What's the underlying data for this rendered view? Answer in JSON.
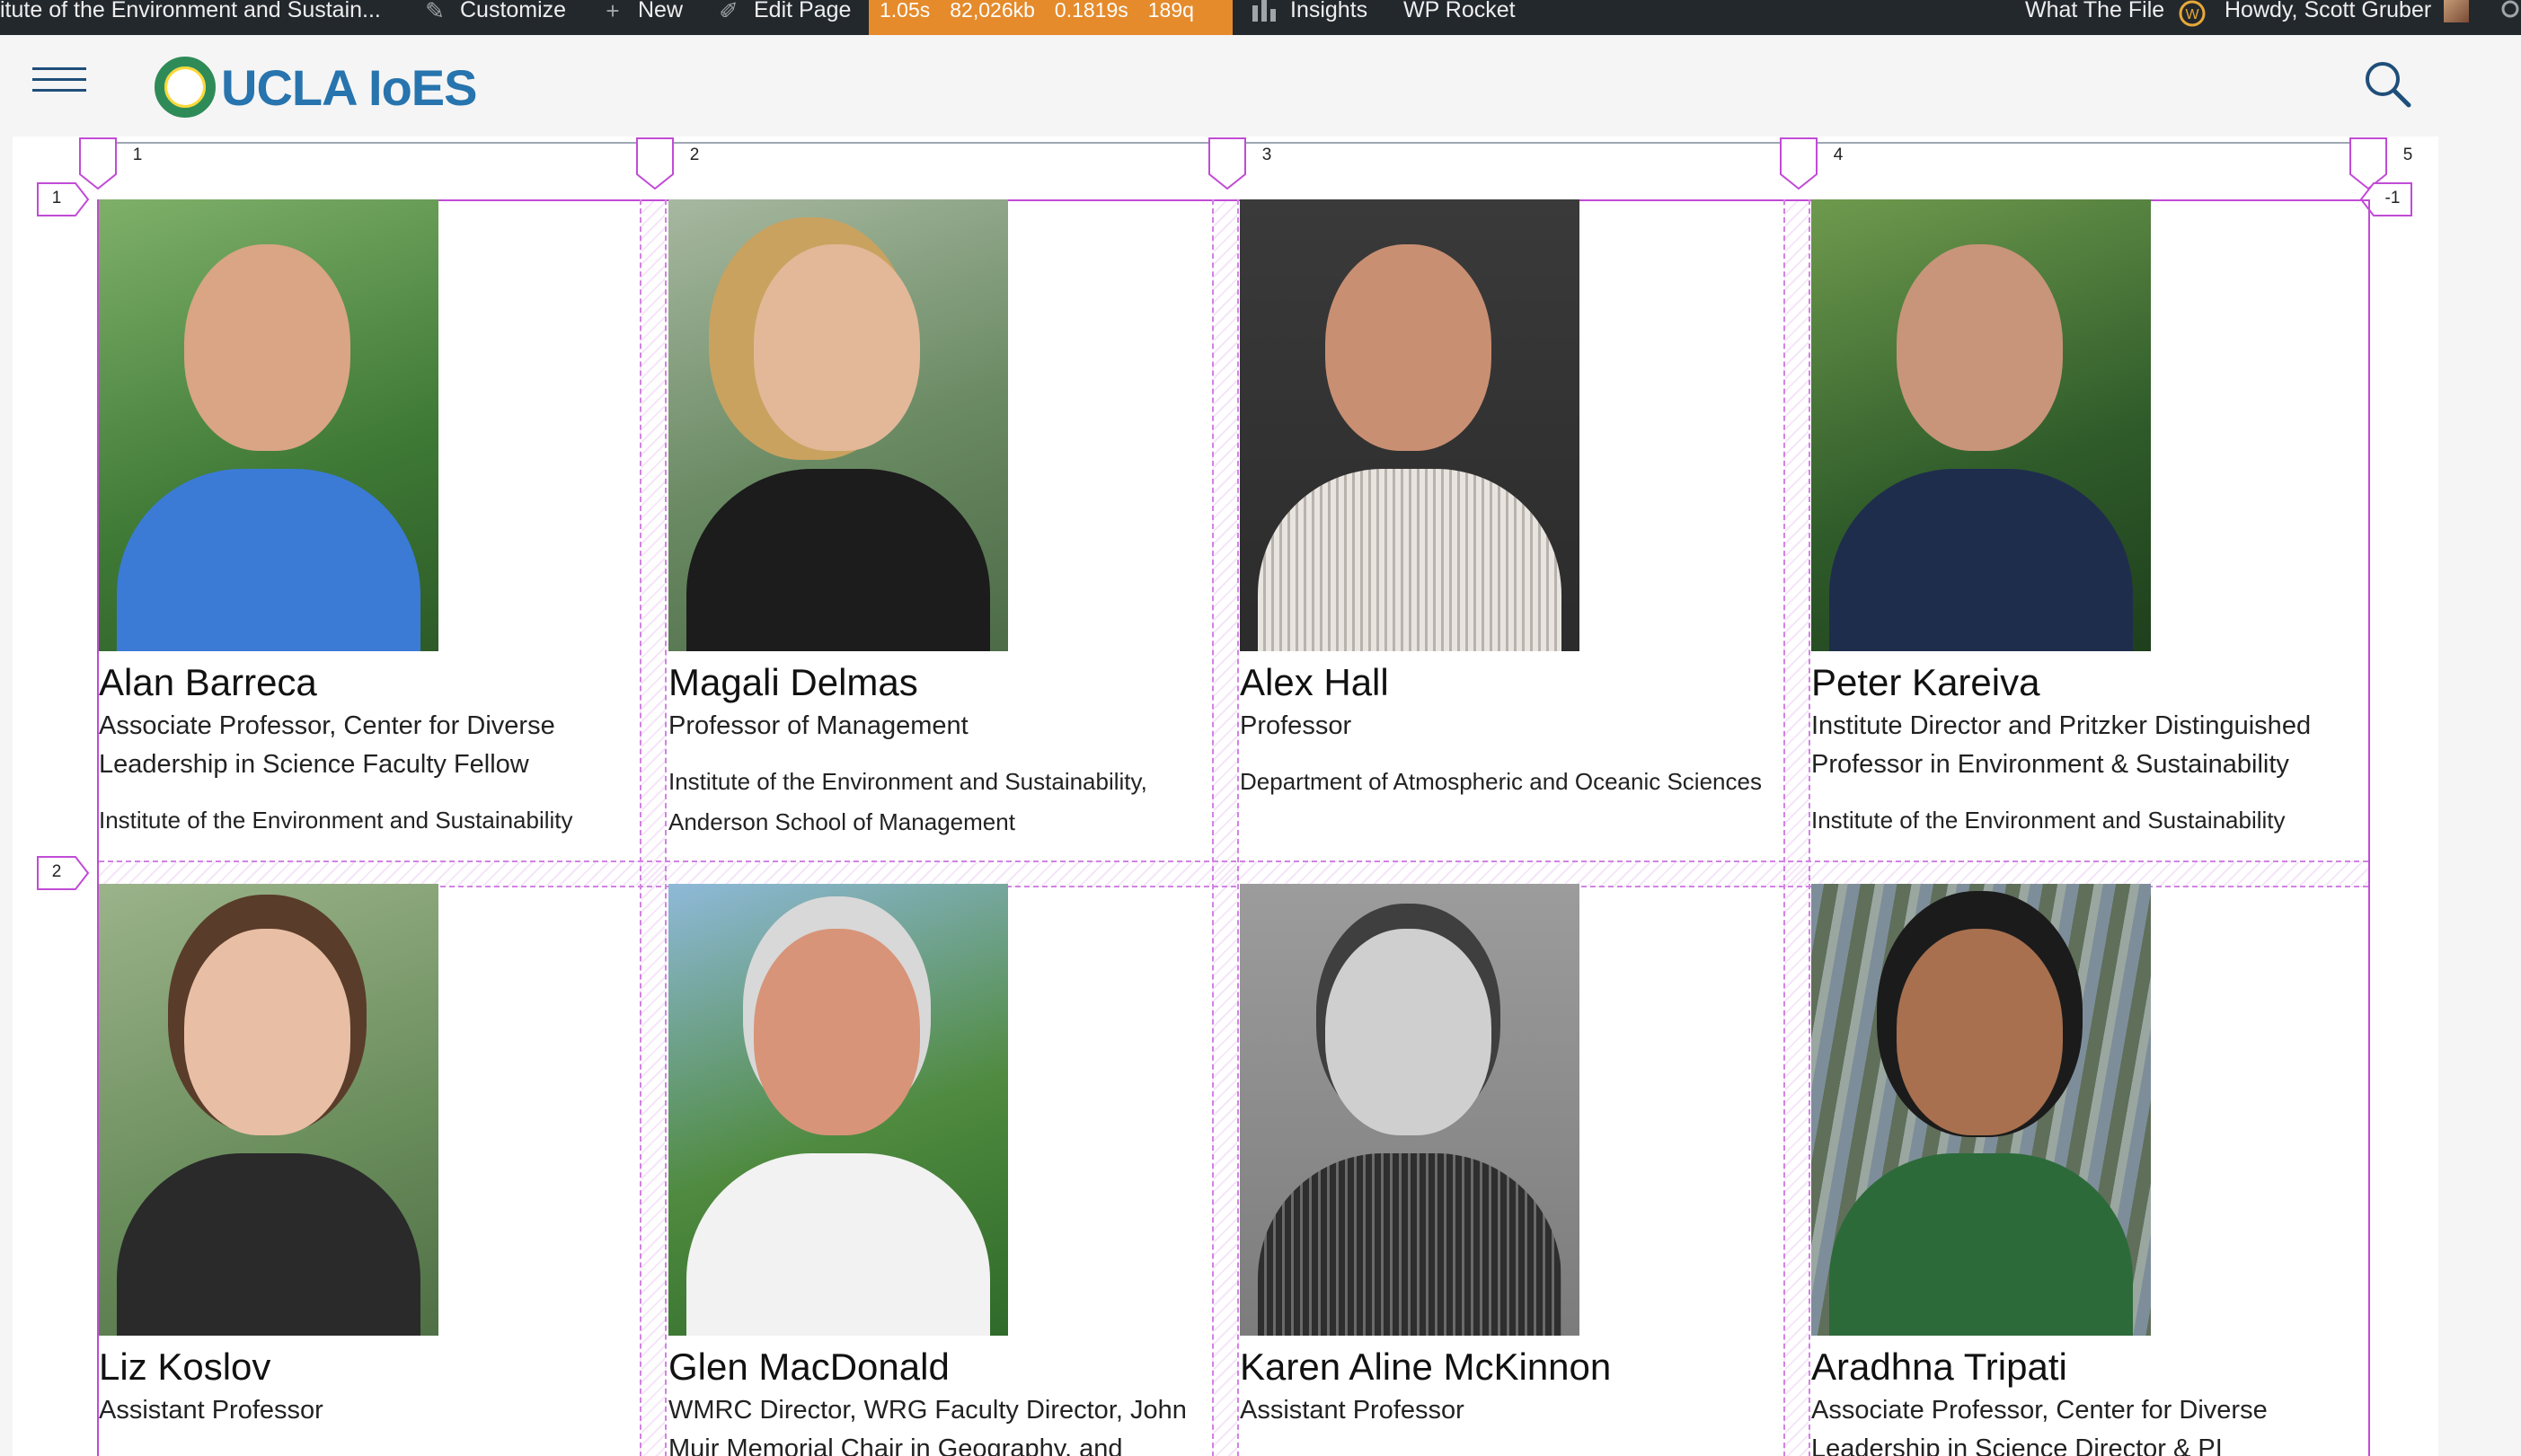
{
  "admin_bar": {
    "site_name": "itute of the Environment and Sustain...",
    "customize": "Customize",
    "new": "New",
    "edit_page": "Edit Page",
    "perf": {
      "time": "1.05s",
      "memory": "82,026kb",
      "query_time": "0.1819s",
      "queries": "189q"
    },
    "insights": "Insights",
    "wp_rocket": "WP Rocket",
    "what_the_file": "What The File",
    "greeting": "Howdy, Scott Gruber"
  },
  "header": {
    "logo_text": "UCLA IoES"
  },
  "grid_overlay": {
    "column_lines": [
      "1",
      "2",
      "3",
      "4",
      "5"
    ],
    "row_lines": [
      "1",
      "2"
    ],
    "end_line": "-1",
    "color": "#c14bd6"
  },
  "people": [
    {
      "name": "Alan Barreca",
      "title": "Associate Professor, Center for Diverse Leadership in Science Faculty Fellow",
      "dept": "Institute of the Environment and Sustainability"
    },
    {
      "name": "Magali Delmas",
      "title": "Professor of Management",
      "dept": "Institute of the Environment and Sustainability, Anderson School of Management"
    },
    {
      "name": "Alex Hall",
      "title": "Professor",
      "dept": "Department of Atmospheric and Oceanic Sciences"
    },
    {
      "name": "Peter Kareiva",
      "title": "Institute Director and Pritzker Distinguished Professor in Environment & Sustainability",
      "dept": "Institute of the Environment and Sustainability"
    },
    {
      "name": "Liz Koslov",
      "title": "Assistant Professor",
      "dept": ""
    },
    {
      "name": "Glen MacDonald",
      "title": "WMRC Director, WRG Faculty Director, John Muir Memorial Chair in Geography, and",
      "dept": ""
    },
    {
      "name": "Karen Aline McKinnon",
      "title": "Assistant Professor",
      "dept": ""
    },
    {
      "name": "Aradhna Tripati",
      "title": "Associate Professor, Center for Diverse Leadership in Science Director & PI",
      "dept": ""
    }
  ],
  "colors": {
    "admin_bar_bg": "#23282d",
    "perf_bg": "#e58b2c",
    "brand_blue": "#2774ae",
    "grid_overlay": "#c14bd6"
  }
}
